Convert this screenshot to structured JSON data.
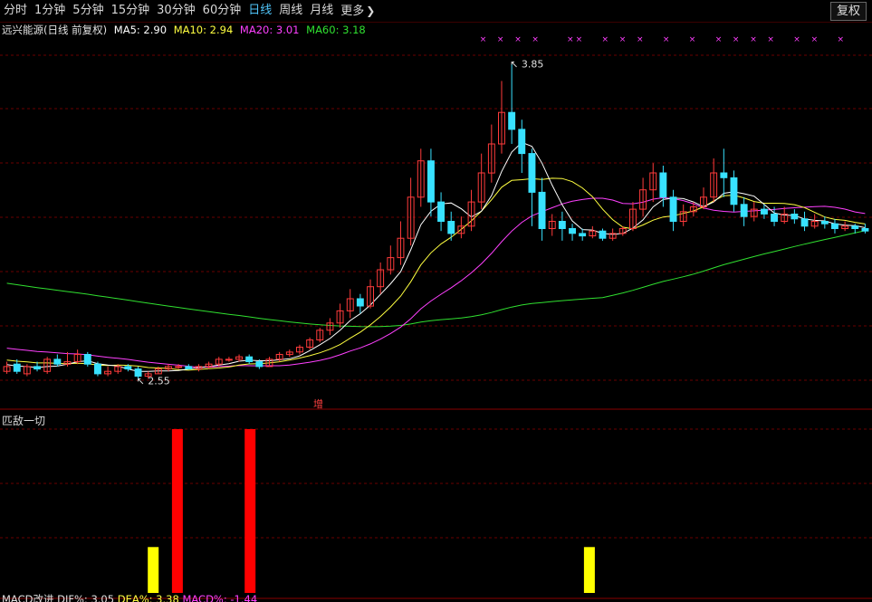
{
  "toolbar": {
    "tabs": [
      "分时",
      "1分钟",
      "5分钟",
      "15分钟",
      "30分钟",
      "60分钟",
      "日线",
      "周线",
      "月线",
      "更多"
    ],
    "active": "日线",
    "right_button": "复权"
  },
  "legend": {
    "name": "远兴能源(日线 前复权)",
    "ma5": "MA5: 2.90",
    "ma10": "MA10: 2.94",
    "ma20": "MA20: 3.01",
    "ma60": "MA60: 3.18"
  },
  "colors": {
    "up": "#ff3b3b",
    "down": "#38e1ff",
    "ma5": "#ffffff",
    "ma10": "#ffff40",
    "ma20": "#ff40ff",
    "ma60": "#30e030",
    "grid": "#6a0000",
    "bar_red": "#ff0000",
    "bar_yellow": "#ffff00"
  },
  "annotations": {
    "high": "3.85",
    "low": "2.55",
    "signal": "增"
  },
  "indicator_title": "匹敌一切",
  "bottom_legend": {
    "name": "MACD改进",
    "dif": "DIF%: 3.05",
    "dea": "DEA%: 3.38",
    "macd": "MACD%: -1.44"
  },
  "chart_data": {
    "type": "candlestick",
    "title": "远兴能源(日线 前复权)",
    "ylim": [
      2.45,
      3.95
    ],
    "high": 3.85,
    "low": 2.55,
    "moving_averages": {
      "MA5": 2.9,
      "MA10": 2.94,
      "MA20": 3.01,
      "MA60": 3.18
    },
    "ohlc": [
      [
        2.58,
        2.6,
        2.57,
        2.62
      ],
      [
        2.61,
        2.58,
        2.57,
        2.63
      ],
      [
        2.57,
        2.6,
        2.56,
        2.61
      ],
      [
        2.6,
        2.59,
        2.58,
        2.62
      ],
      [
        2.58,
        2.63,
        2.57,
        2.64
      ],
      [
        2.63,
        2.61,
        2.6,
        2.65
      ],
      [
        2.61,
        2.62,
        2.6,
        2.66
      ],
      [
        2.62,
        2.65,
        2.61,
        2.67
      ],
      [
        2.65,
        2.61,
        2.6,
        2.66
      ],
      [
        2.61,
        2.57,
        2.56,
        2.62
      ],
      [
        2.57,
        2.58,
        2.56,
        2.6
      ],
      [
        2.58,
        2.6,
        2.57,
        2.61
      ],
      [
        2.6,
        2.59,
        2.58,
        2.61
      ],
      [
        2.59,
        2.56,
        2.55,
        2.6
      ],
      [
        2.56,
        2.57,
        2.55,
        2.58
      ],
      [
        2.57,
        2.59,
        2.57,
        2.6
      ],
      [
        2.59,
        2.6,
        2.58,
        2.61
      ],
      [
        2.6,
        2.6,
        2.59,
        2.61
      ],
      [
        2.6,
        2.59,
        2.59,
        2.61
      ],
      [
        2.59,
        2.6,
        2.58,
        2.61
      ],
      [
        2.6,
        2.61,
        2.59,
        2.62
      ],
      [
        2.61,
        2.63,
        2.6,
        2.64
      ],
      [
        2.63,
        2.63,
        2.62,
        2.64
      ],
      [
        2.63,
        2.64,
        2.62,
        2.65
      ],
      [
        2.64,
        2.62,
        2.61,
        2.65
      ],
      [
        2.62,
        2.6,
        2.59,
        2.63
      ],
      [
        2.6,
        2.63,
        2.6,
        2.64
      ],
      [
        2.63,
        2.65,
        2.62,
        2.66
      ],
      [
        2.65,
        2.66,
        2.64,
        2.67
      ],
      [
        2.66,
        2.68,
        2.65,
        2.69
      ],
      [
        2.68,
        2.71,
        2.67,
        2.72
      ],
      [
        2.71,
        2.75,
        2.7,
        2.76
      ],
      [
        2.75,
        2.78,
        2.73,
        2.8
      ],
      [
        2.78,
        2.83,
        2.76,
        2.86
      ],
      [
        2.83,
        2.88,
        2.8,
        2.92
      ],
      [
        2.88,
        2.85,
        2.82,
        2.9
      ],
      [
        2.85,
        2.93,
        2.84,
        2.96
      ],
      [
        2.93,
        3.0,
        2.9,
        3.03
      ],
      [
        3.0,
        3.05,
        2.98,
        3.1
      ],
      [
        3.05,
        3.13,
        3.02,
        3.2
      ],
      [
        3.13,
        3.3,
        3.1,
        3.38
      ],
      [
        3.3,
        3.45,
        3.26,
        3.5
      ],
      [
        3.45,
        3.28,
        3.22,
        3.5
      ],
      [
        3.28,
        3.2,
        3.16,
        3.32
      ],
      [
        3.2,
        3.15,
        3.12,
        3.24
      ],
      [
        3.15,
        3.18,
        3.13,
        3.22
      ],
      [
        3.18,
        3.28,
        3.16,
        3.33
      ],
      [
        3.28,
        3.4,
        3.25,
        3.48
      ],
      [
        3.4,
        3.52,
        3.36,
        3.6
      ],
      [
        3.52,
        3.65,
        3.48,
        3.78
      ],
      [
        3.65,
        3.58,
        3.52,
        3.85
      ],
      [
        3.58,
        3.48,
        3.4,
        3.62
      ],
      [
        3.48,
        3.32,
        3.18,
        3.5
      ],
      [
        3.32,
        3.17,
        3.12,
        3.38
      ],
      [
        3.17,
        3.2,
        3.14,
        3.23
      ],
      [
        3.2,
        3.17,
        3.12,
        3.24
      ],
      [
        3.17,
        3.15,
        3.12,
        3.19
      ],
      [
        3.15,
        3.14,
        3.12,
        3.17
      ],
      [
        3.14,
        3.16,
        3.13,
        3.18
      ],
      [
        3.16,
        3.13,
        3.12,
        3.17
      ],
      [
        3.13,
        3.15,
        3.12,
        3.17
      ],
      [
        3.15,
        3.17,
        3.14,
        3.18
      ],
      [
        3.17,
        3.25,
        3.16,
        3.28
      ],
      [
        3.25,
        3.33,
        3.22,
        3.38
      ],
      [
        3.33,
        3.4,
        3.28,
        3.44
      ],
      [
        3.4,
        3.3,
        3.26,
        3.43
      ],
      [
        3.3,
        3.2,
        3.16,
        3.33
      ],
      [
        3.2,
        3.24,
        3.18,
        3.27
      ],
      [
        3.24,
        3.26,
        3.22,
        3.28
      ],
      [
        3.26,
        3.3,
        3.25,
        3.34
      ],
      [
        3.3,
        3.4,
        3.28,
        3.46
      ],
      [
        3.4,
        3.38,
        3.3,
        3.5
      ],
      [
        3.38,
        3.27,
        3.24,
        3.41
      ],
      [
        3.27,
        3.22,
        3.18,
        3.3
      ],
      [
        3.22,
        3.25,
        3.2,
        3.28
      ],
      [
        3.25,
        3.23,
        3.21,
        3.27
      ],
      [
        3.23,
        3.2,
        3.18,
        3.26
      ],
      [
        3.2,
        3.23,
        3.19,
        3.26
      ],
      [
        3.23,
        3.21,
        3.19,
        3.25
      ],
      [
        3.21,
        3.18,
        3.16,
        3.24
      ],
      [
        3.18,
        3.2,
        3.17,
        3.23
      ],
      [
        3.2,
        3.19,
        3.17,
        3.22
      ],
      [
        3.19,
        3.17,
        3.15,
        3.21
      ],
      [
        3.17,
        3.18,
        3.16,
        3.2
      ],
      [
        3.18,
        3.17,
        3.15,
        3.19
      ],
      [
        3.17,
        3.16,
        3.15,
        3.19
      ]
    ],
    "markers_top": [
      0.55,
      0.57,
      0.59,
      0.61,
      0.65,
      0.66,
      0.69,
      0.71,
      0.73,
      0.76,
      0.79,
      0.82,
      0.84,
      0.86,
      0.88,
      0.91,
      0.93,
      0.96
    ],
    "indicator": {
      "title": "匹敌一切",
      "bars": [
        {
          "x_index": 6,
          "color": "yellow",
          "value": 0.28
        },
        {
          "x_index": 7,
          "color": "red",
          "value": 1.0
        },
        {
          "x_index": 10,
          "color": "red",
          "value": 1.0
        },
        {
          "x_index": 24,
          "color": "yellow",
          "value": 0.28
        }
      ]
    }
  }
}
